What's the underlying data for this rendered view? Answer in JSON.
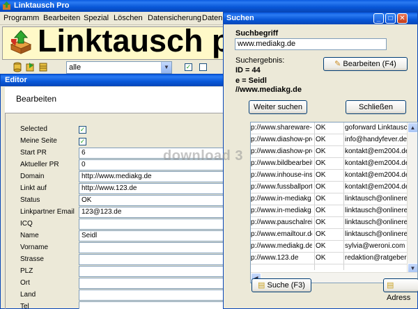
{
  "main_window": {
    "title": "Linktausch Pro",
    "menu": [
      "Programm",
      "Bearbeiten",
      "Spezial",
      "Löschen",
      "Datensicherung",
      "Datenb"
    ],
    "banner_text": "Linktausch pr",
    "filter_select": "alle"
  },
  "editor": {
    "title": "Editor",
    "heading": "Bearbeiten",
    "fields": [
      {
        "label": "Selected",
        "type": "checkbox",
        "checked": true
      },
      {
        "label": "Meine Seite",
        "type": "checkbox",
        "checked": true
      },
      {
        "label": "Start PR",
        "value": "6"
      },
      {
        "label": "Aktueller PR",
        "value": "0"
      },
      {
        "label": "Domain",
        "value": "http://www.mediakg.de"
      },
      {
        "label": "Linkt auf",
        "value": "http://www.123.de"
      },
      {
        "label": "Status",
        "value": "OK"
      },
      {
        "label": "Linkpartner Email",
        "value": "123@123.de"
      },
      {
        "label": "ICQ",
        "value": ""
      },
      {
        "label": "Name",
        "value": "Seidl"
      },
      {
        "label": "Vorname",
        "value": ""
      },
      {
        "label": "Strasse",
        "value": ""
      },
      {
        "label": "PLZ",
        "value": ""
      },
      {
        "label": "Ort",
        "value": ""
      },
      {
        "label": "Land",
        "value": ""
      },
      {
        "label": "Tel",
        "value": ""
      }
    ]
  },
  "search": {
    "title": "Suchen",
    "suchbegriff_label": "Suchbegriff",
    "suchbegriff_value": "www.mediakg.de",
    "ergebnis_label": "Suchergebnis:",
    "result_id": "ID = 44",
    "result_name": "e = Seidl",
    "result_url": "//www.mediakg.de",
    "bearbeiten_button": "Bearbeiten (F4)",
    "weiter_button": "Weiter suchen",
    "schliessen_button": "Schließen",
    "suche_button": "Suche (F3)",
    "adresse_button": "Adress",
    "rows": [
      [
        "p://www.shareware-p",
        "OK",
        "goforward Linktausch"
      ],
      [
        "p://www.diashow-pro",
        "OK",
        "info@handyfever.de"
      ],
      [
        "p://www.diashow-pro",
        "OK",
        "kontakt@em2004.de"
      ],
      [
        "p://www.bildbearbeit",
        "OK",
        "kontakt@em2004.de"
      ],
      [
        "p://www.inhouse-insp",
        "OK",
        "kontakt@em2004.de"
      ],
      [
        "p://www.fussballport",
        "OK",
        "kontakt@em2004.de"
      ],
      [
        "p://www.in-mediakg.",
        "OK",
        "linktausch@onlinereis"
      ],
      [
        "p://www.in-mediakg.",
        "OK",
        "linktausch@onlinereis"
      ],
      [
        "p://www.pauschalrei",
        "OK",
        "linktausch@onlinereis"
      ],
      [
        "p://www.emailtour.de",
        "OK",
        "linktausch@onlinereis"
      ],
      [
        "p://www.mediakg.de",
        "OK",
        "sylvia@weroni.com"
      ],
      [
        "p://www.123.de",
        "OK",
        "redaktion@ratgeber1"
      ]
    ]
  },
  "watermark": "download 3"
}
